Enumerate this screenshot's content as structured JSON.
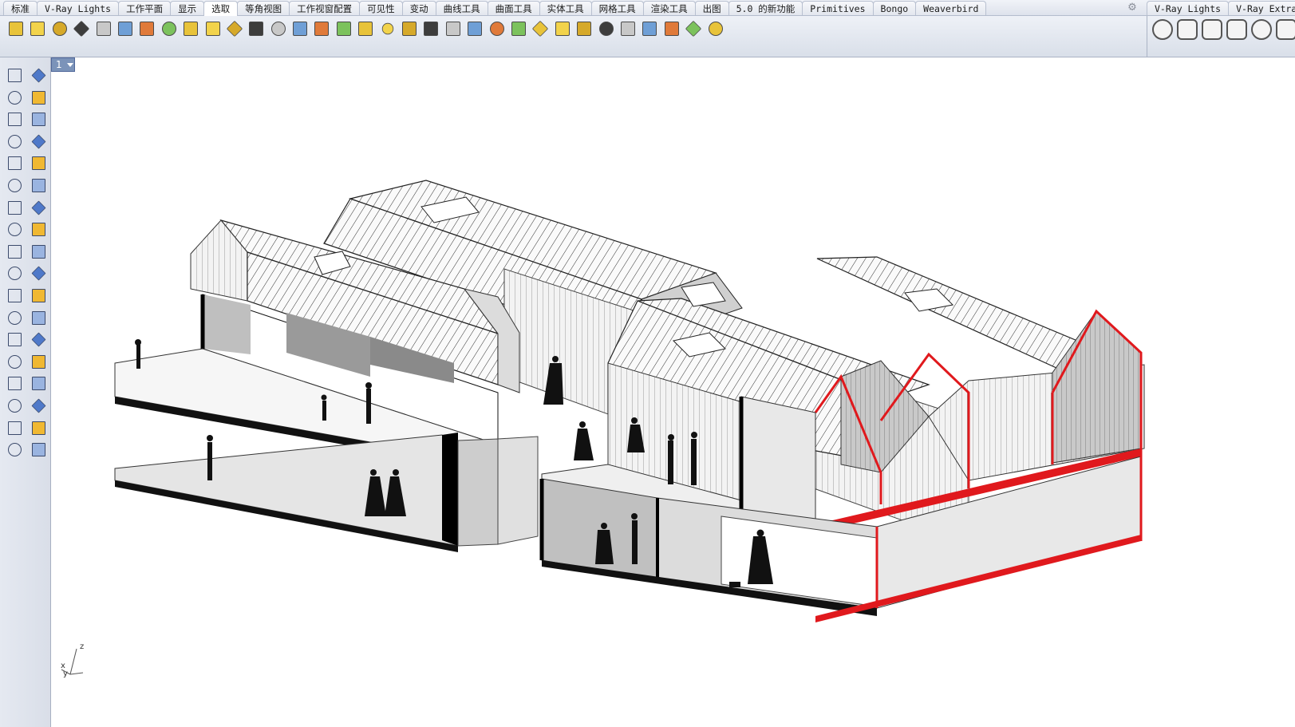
{
  "menu_tabs": [
    "标准",
    "V-Ray Lights",
    "工作平面",
    "显示",
    "选取",
    "等角视图",
    "工作视窗配置",
    "可见性",
    "变动",
    "曲线工具",
    "曲面工具",
    "实体工具",
    "网格工具",
    "渲染工具",
    "出图",
    "5.0 的新功能",
    "Primitives",
    "Bongo",
    "Weaverbird"
  ],
  "active_tab": "选取",
  "right_tabs": [
    "V-Ray Lights",
    "V-Ray Extra"
  ],
  "viewport": {
    "tab_label": "1"
  },
  "axis": {
    "x": "x",
    "y": "y",
    "z": "z"
  },
  "colors": {
    "accent_section": "#e0191d",
    "tab_active": "#ffffff",
    "viewport_tab": "#7b93b9"
  },
  "toolbar_icons": [
    "select-points-icon",
    "select-all-icon",
    "select-by-color-icon",
    "select-solids-icon",
    "select-curves-icon",
    "select-lights-icon",
    "select-annotations-icon",
    "select-polysurfaces-icon",
    "select-color-wheel-icon",
    "select-surfaces-icon",
    "select-point-cloud-icon",
    "select-control-points-icon",
    "select-meshes-icon",
    "select-filter-icon",
    "select-hatch-icon",
    "select-dimensions-icon",
    "select-blocks-icon",
    "select-groups-icon",
    "select-render-icon",
    "select-extrusion-icon",
    "select-planar-icon",
    "select-layer-icon",
    "select-spiral-icon",
    "select-duplicates-icon",
    "select-linked-icon",
    "select-open-icon",
    "select-sphere-icon",
    "select-box-icon",
    "select-material-icon",
    "select-paint-icon",
    "select-brush-icon",
    "find-icon",
    "filter-icon"
  ],
  "left_tools": [
    "select-arrow-icon",
    "point-icon",
    "polyline-icon",
    "curve-icon",
    "circle-icon",
    "ellipse-icon",
    "polygon-icon",
    "rectangle-icon",
    "arc-icon",
    "fillet-curve-icon",
    "surface-icon",
    "loft-icon",
    "box-icon",
    "sphere-icon",
    "cylinder-icon",
    "plane-icon",
    "gear-tools-icon",
    "transform-icon",
    "trim-icon",
    "split-icon",
    "boolean-icon",
    "group-icon",
    "offset-icon",
    "fillet-icon",
    "text-icon",
    "scale-icon",
    "array-icon",
    "mirror-icon",
    "mesh-icon",
    "dimension-icon",
    "grid-icon",
    "history-icon",
    "render-icon",
    "check-icon",
    "solid-icon",
    "paint-bucket-icon"
  ]
}
